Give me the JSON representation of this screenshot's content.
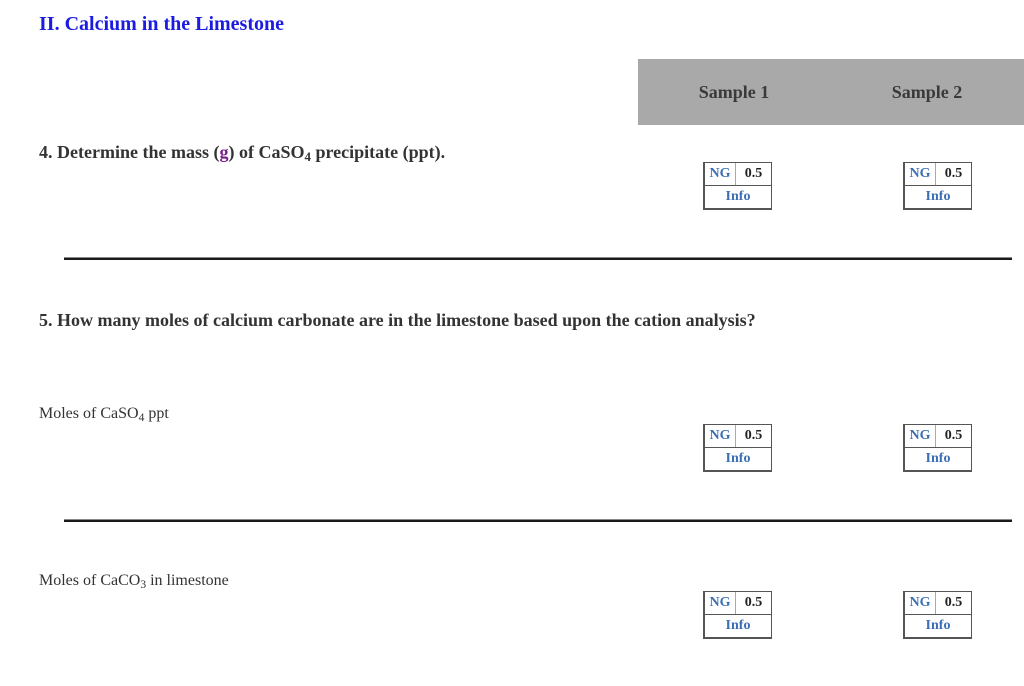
{
  "section": {
    "title": "II. Calcium in the Limestone"
  },
  "sample_headers": [
    "Sample 1",
    "Sample 2"
  ],
  "questions": {
    "q4": {
      "prefix": "4. Determine the mass (",
      "unit": "g",
      "mid": ") of CaSO",
      "sub": "4",
      "suffix": " precipitate (ppt)."
    },
    "q5": {
      "text": "5. How many moles of calcium carbonate are in the limestone based upon the cation analysis?"
    }
  },
  "labels": {
    "moles_caso4": {
      "pre": "Moles of CaSO",
      "sub": "4",
      "post": " ppt"
    },
    "moles_caco3": {
      "pre": "Moles of CaCO",
      "sub": "3",
      "post": " in limestone"
    }
  },
  "grade_boxes": {
    "q4_s1": {
      "ng": "NG",
      "points": "0.5",
      "info": "Info"
    },
    "q4_s2": {
      "ng": "NG",
      "points": "0.5",
      "info": "Info"
    },
    "caso4_s1": {
      "ng": "NG",
      "points": "0.5",
      "info": "Info"
    },
    "caso4_s2": {
      "ng": "NG",
      "points": "0.5",
      "info": "Info"
    },
    "caco3_s1": {
      "ng": "NG",
      "points": "0.5",
      "info": "Info"
    },
    "caco3_s2": {
      "ng": "NG",
      "points": "0.5",
      "info": "Info"
    }
  },
  "colors": {
    "title": "#1c1ce0",
    "header_bg": "#a9a9a9",
    "link": "#3d6fb4",
    "unit_highlight": "#7a1e8c"
  }
}
